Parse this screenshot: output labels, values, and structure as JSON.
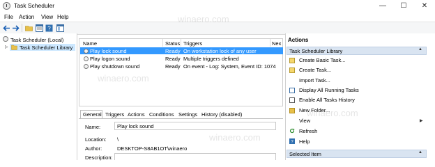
{
  "window": {
    "title": "Task Scheduler"
  },
  "menu": [
    "File",
    "Action",
    "View",
    "Help"
  ],
  "tree": {
    "root": "Task Scheduler (Local)",
    "child": "Task Scheduler Library"
  },
  "task_list": {
    "columns": [
      "Name",
      "Status",
      "Triggers",
      "Nex"
    ],
    "rows": [
      {
        "name": "Play lock sound",
        "status": "Ready",
        "triggers": "On workstation lock of any user"
      },
      {
        "name": "Play logon sound",
        "status": "Ready",
        "triggers": "Multiple triggers defined"
      },
      {
        "name": "Play shutdown sound",
        "status": "Ready",
        "triggers": "On event - Log: System, Event ID: 1074"
      }
    ],
    "selected_index": 0
  },
  "detail_tabs": [
    "General",
    "Triggers",
    "Actions",
    "Conditions",
    "Settings",
    "History (disabled)"
  ],
  "details": {
    "name_label": "Name:",
    "name_value": "Play lock sound",
    "location_label": "Location:",
    "location_value": "\\",
    "author_label": "Author:",
    "author_value": "DESKTOP-S8AB1OT\\winaero",
    "description_label": "Description:"
  },
  "actions_panel": {
    "title": "Actions",
    "section1": "Task Scheduler Library",
    "items": [
      "Create Basic Task...",
      "Create Task...",
      "Import Task...",
      "Display All Running Tasks",
      "Enable All Tasks History",
      "New Folder...",
      "View",
      "Refresh",
      "Help"
    ],
    "section2": "Selected Item"
  },
  "watermark": "winaero.com",
  "colors": {
    "selection": "#3399ff",
    "tree_selection": "#cde8ff",
    "section_header": "#d9e4f1"
  }
}
